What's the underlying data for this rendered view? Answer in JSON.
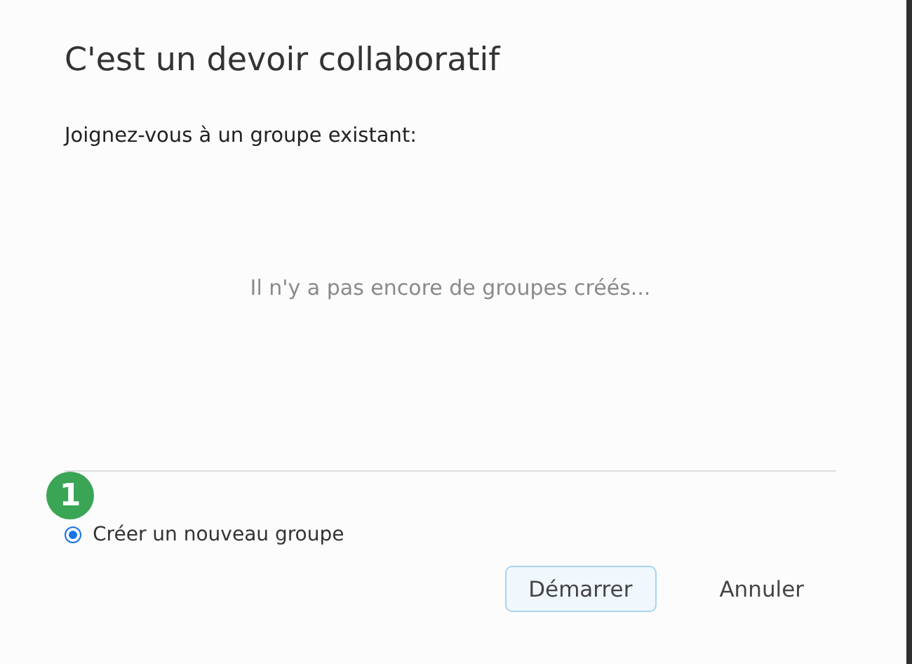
{
  "dialog": {
    "title": "C'est un devoir collaboratif",
    "subtitle": "Joignez-vous à un groupe existant:",
    "empty_message": "Il n'y a pas encore de groupes créés...",
    "step_badge": "1",
    "options": [
      {
        "label": "Créer un nouveau groupe",
        "selected": true
      }
    ],
    "buttons": [
      {
        "label": "Démarrer",
        "kind": "primary"
      },
      {
        "label": "Annuler",
        "kind": "secondary"
      }
    ]
  }
}
